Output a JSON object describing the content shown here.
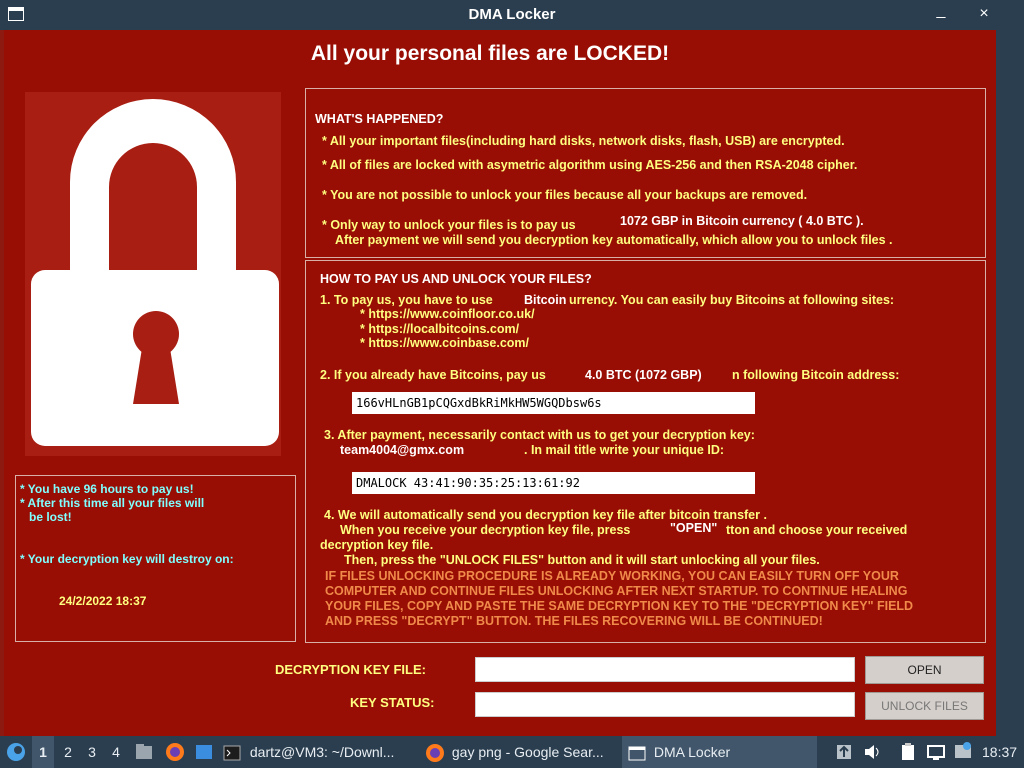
{
  "window": {
    "title": "DMA Locker",
    "minimize_glyph": "_",
    "close_glyph": "×"
  },
  "header": {
    "headline": "All your personal files are LOCKED!"
  },
  "happened": {
    "heading": "WHAT'S HAPPENED?",
    "line1": "* All your important files(including hard disks, network disks, flash, USB) are encrypted.",
    "line2": "* All of files are locked with asymetric algorithm using AES-256 and then RSA-2048 cipher.",
    "line3": "* You are not possible to unlock your files because all your backups are removed.",
    "line4_prefix": "* Only way to unlock your files is to pay us",
    "line4_amount": "1072 GBP in Bitcoin currency ( 4.0 BTC ).",
    "line5": "After payment we will send you decryption key automatically, which allow you to unlock files ."
  },
  "howto": {
    "heading": "HOW TO PAY US AND UNLOCK YOUR FILES?",
    "step1_prefix": "1. To pay us, you have to use",
    "step1_bitcoin": "Bitcoin",
    "step1_suffix": "urrency. You can easily buy Bitcoins at following sites:",
    "sites": [
      "* https://www.coinfloor.co.uk/",
      "* https://localbitcoins.com/",
      "* https://www.coinbase.com/"
    ],
    "step2_prefix": "2. If you already have Bitcoins, pay us",
    "step2_amount": "4.0 BTC (1072 GBP)",
    "step2_suffix": "n following Bitcoin address:",
    "btc_address": "166vHLnGB1pCQGxdBkRiMkHW5WGQDbsw6s",
    "step3": "3. After payment, necessarily contact with us to get your decryption key:",
    "email": "team4004@gmx.com",
    "step3_suffix": ". In mail title write your unique ID:",
    "unique_id": "DMALOCK 43:41:90:35:25:13:61:92",
    "step4": "4. We will automatically send you decryption key file after bitcoin transfer .",
    "step4_b_prefix": "When you receive your decryption key file, press",
    "step4_open": "\"OPEN\"",
    "step4_b_suffix": "tton and choose your received",
    "step4_c": "decryption key file.",
    "step4_d": "Then,  press the \"UNLOCK FILES\" button and it will start unlocking all your files.",
    "warning": [
      "IF FILES UNLOCKING PROCEDURE IS ALREADY WORKING, YOU CAN EASILY TURN OFF YOUR",
      "COMPUTER AND CONTINUE FILES UNLOCKING AFTER NEXT STARTUP. TO CONTINUE HEALING",
      "YOUR FILES, COPY AND PASTE THE SAME DECRYPTION KEY TO THE \"DECRYPTION  KEY\" FIELD",
      "AND PRESS \"DECRYPT\" BUTTON. THE FILES RECOVERING WILL BE CONTINUED!"
    ]
  },
  "countdown": {
    "line1": "* You have 96 hours to pay us!",
    "line2": "* After this time all your files will",
    "line3": "be lost!",
    "line4": "* Your decryption key will destroy on:",
    "date": "24/2/2022 18:37"
  },
  "controls": {
    "key_file_label": "DECRYPTION KEY FILE:",
    "key_file_value": "",
    "open_button": "OPEN",
    "status_label": "KEY STATUS:",
    "status_value": "",
    "unlock_button": "UNLOCK FILES"
  },
  "taskbar": {
    "workspaces": [
      "1",
      "2",
      "3",
      "4"
    ],
    "tasks": [
      "dartz@VM3: ~/Downl...",
      "gay png - Google Sear...",
      "DMA Locker"
    ],
    "clock": "18:37"
  },
  "colors": {
    "body": "#980d04",
    "titlebar": "#2b3e4f",
    "accent_yellow": "#ffff80",
    "warning_orange": "#f08a4a",
    "cyan": "#80ffff"
  }
}
